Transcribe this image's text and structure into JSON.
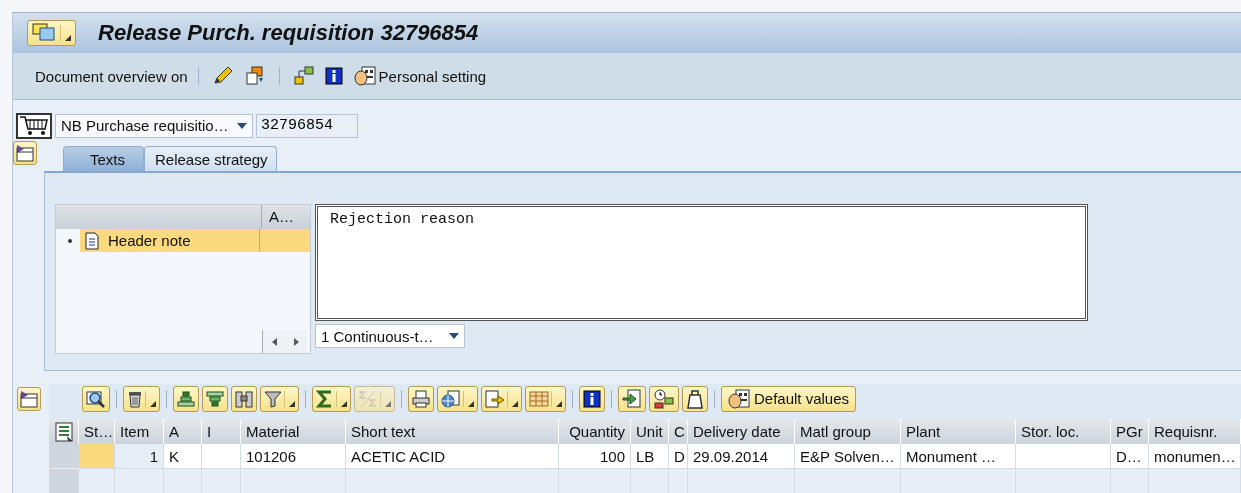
{
  "window": {
    "title": "Release Purch. requisition 32796854"
  },
  "app_toolbar": {
    "overview_button": "Document overview on",
    "personal_setting_button": "Personal setting"
  },
  "document": {
    "type": "NB Purchase requisitio…",
    "number": "32796854"
  },
  "tabs": [
    {
      "label": "Texts",
      "selected": true
    },
    {
      "label": "Release strategy",
      "selected": false
    }
  ],
  "texts": {
    "tree_column_2": "A…",
    "tree_items": [
      {
        "label": "Header note",
        "selected": true
      }
    ],
    "editor_value": "Rejection reason",
    "format": "1 Continuous-t…"
  },
  "items_toolbar": {
    "default_values_button": "Default values"
  },
  "table": {
    "columns": [
      "St…",
      "Item",
      "A",
      "I",
      "Material",
      "Short text",
      "Quantity",
      "Unit",
      "C",
      "Delivery date",
      "Matl group",
      "Plant",
      "Stor. loc.",
      "PGr",
      "Requisnr."
    ],
    "rows": [
      {
        "status_highlight": true,
        "cells": [
          "",
          "1",
          "K",
          "",
          "101206",
          "ACETIC ACID",
          "100",
          "LB",
          "D",
          "29.09.2014",
          "E&P Solven…",
          "Monument …",
          "",
          "D…",
          "monumen…"
        ]
      }
    ]
  }
}
